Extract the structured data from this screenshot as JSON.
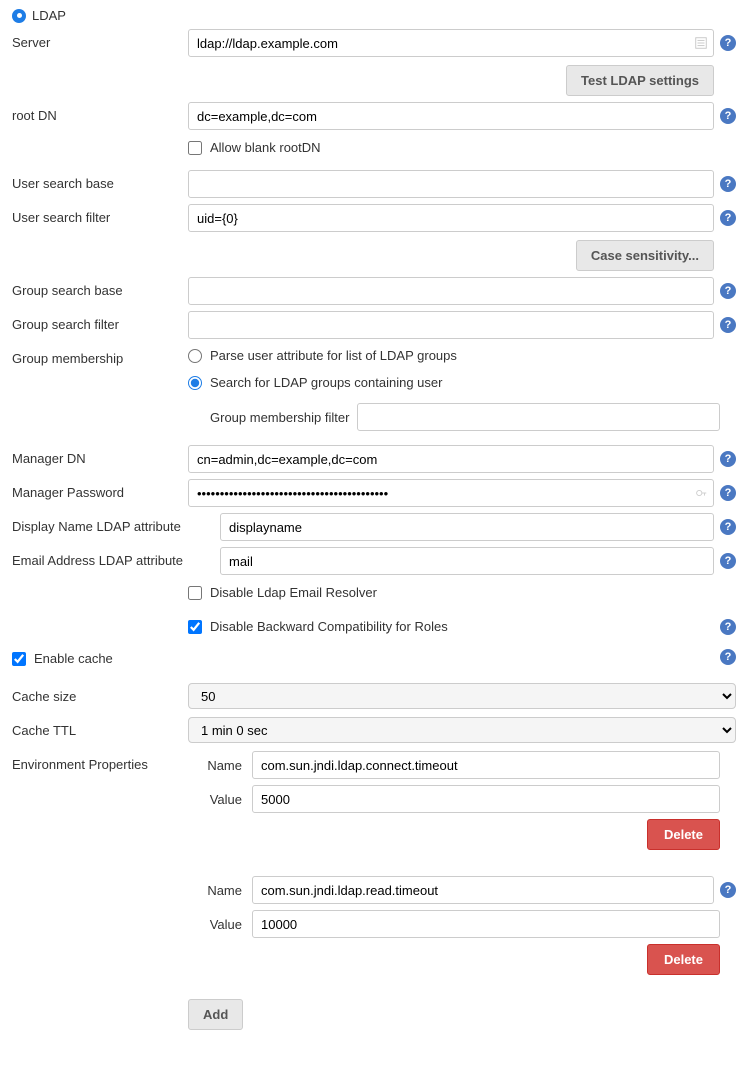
{
  "section_title": "LDAP",
  "labels": {
    "server": "Server",
    "root_dn": "root DN",
    "allow_blank_rootdn": "Allow blank rootDN",
    "user_search_base": "User search base",
    "user_search_filter": "User search filter",
    "group_search_base": "Group search base",
    "group_search_filter": "Group search filter",
    "group_membership": "Group membership",
    "gm_parse": "Parse user attribute for list of LDAP groups",
    "gm_search": "Search for LDAP groups containing user",
    "gm_filter": "Group membership filter",
    "manager_dn": "Manager DN",
    "manager_password": "Manager Password",
    "display_name_attr": "Display Name LDAP attribute",
    "email_attr": "Email Address LDAP attribute",
    "disable_email_resolver": "Disable Ldap Email Resolver",
    "disable_backward_compat": "Disable Backward Compatibility for Roles",
    "enable_cache": "Enable cache",
    "cache_size": "Cache size",
    "cache_ttl": "Cache TTL",
    "env_props": "Environment Properties",
    "env_name": "Name",
    "env_value": "Value"
  },
  "values": {
    "server": "ldap://ldap.example.com",
    "root_dn": "dc=example,dc=com",
    "allow_blank_rootdn": false,
    "user_search_base": "",
    "user_search_filter": "uid={0}",
    "group_search_base": "",
    "group_search_filter": "",
    "gm_selected": "search",
    "gm_filter": "",
    "manager_dn": "cn=admin,dc=example,dc=com",
    "manager_password": "••••••••••••••••••••••••••••••••••••••••••",
    "display_name_attr": "displayname",
    "email_attr": "mail",
    "disable_email_resolver": false,
    "disable_backward_compat": true,
    "enable_cache": true,
    "cache_size": "50",
    "cache_ttl": "1 min 0 sec"
  },
  "buttons": {
    "test_ldap": "Test LDAP settings",
    "case_sensitivity": "Case sensitivity...",
    "delete": "Delete",
    "add": "Add"
  },
  "env_props": [
    {
      "name": "com.sun.jndi.ldap.connect.timeout",
      "value": "5000"
    },
    {
      "name": "com.sun.jndi.ldap.read.timeout",
      "value": "10000"
    }
  ]
}
